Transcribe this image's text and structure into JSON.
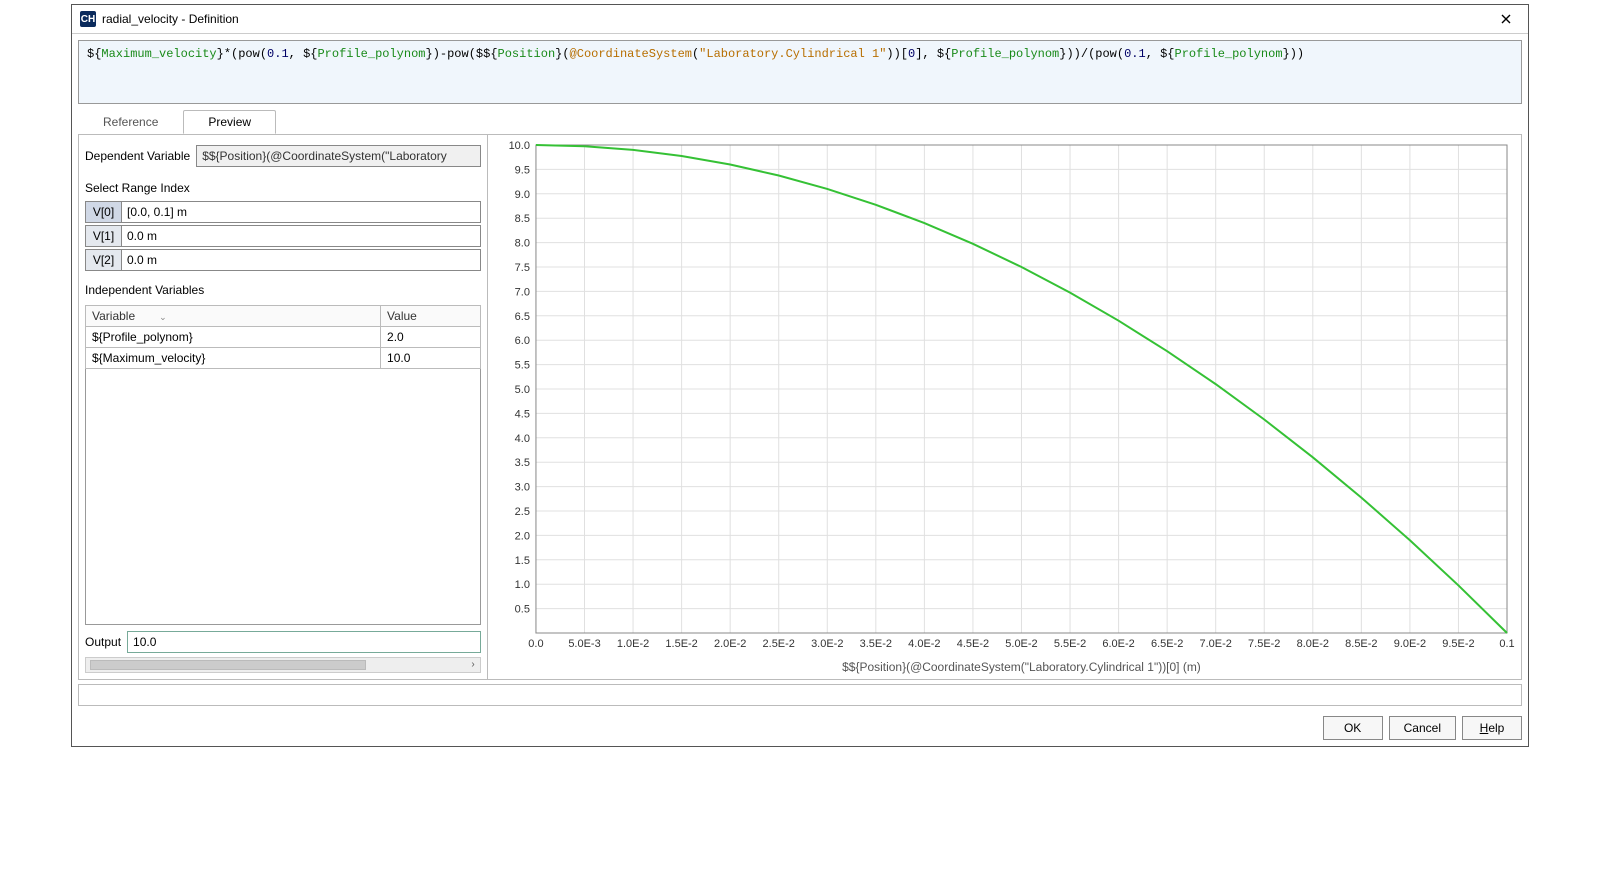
{
  "window": {
    "title": "radial_velocity - Definition"
  },
  "formula": {
    "segments": [
      {
        "t": "${",
        "c": "op"
      },
      {
        "t": "Maximum_velocity",
        "c": "var"
      },
      {
        "t": "}",
        "c": "op"
      },
      {
        "t": "*(pow(",
        "c": "op"
      },
      {
        "t": "0.1",
        "c": "num"
      },
      {
        "t": ", ",
        "c": "op"
      },
      {
        "t": "${",
        "c": "op"
      },
      {
        "t": "Profile_polynom",
        "c": "var"
      },
      {
        "t": "}",
        "c": "op"
      },
      {
        "t": ")-pow(",
        "c": "op"
      },
      {
        "t": "$${",
        "c": "op"
      },
      {
        "t": "Position",
        "c": "var"
      },
      {
        "t": "}",
        "c": "op"
      },
      {
        "t": "(",
        "c": "op"
      },
      {
        "t": "@CoordinateSystem",
        "c": "anno"
      },
      {
        "t": "(",
        "c": "op"
      },
      {
        "t": "\"Laboratory.Cylindrical 1\"",
        "c": "str"
      },
      {
        "t": "))[",
        "c": "op"
      },
      {
        "t": "0",
        "c": "num"
      },
      {
        "t": "], ",
        "c": "op"
      },
      {
        "t": "${",
        "c": "op"
      },
      {
        "t": "Profile_polynom",
        "c": "var"
      },
      {
        "t": "}",
        "c": "op"
      },
      {
        "t": "))/(pow(",
        "c": "op"
      },
      {
        "t": "0.1",
        "c": "num"
      },
      {
        "t": ", ",
        "c": "op"
      },
      {
        "t": "${",
        "c": "op"
      },
      {
        "t": "Profile_polynom",
        "c": "var"
      },
      {
        "t": "}",
        "c": "op"
      },
      {
        "t": "))",
        "c": "op"
      }
    ]
  },
  "tabs": {
    "reference": "Reference",
    "preview": "Preview",
    "active": "preview"
  },
  "left": {
    "dependent_label": "Dependent Variable",
    "dependent_value": "$${Position}(@CoordinateSystem(\"Laboratory",
    "range_label": "Select Range Index",
    "ranges": [
      {
        "idx": "V[0]",
        "val": "[0.0, 0.1] m",
        "selected": true
      },
      {
        "idx": "V[1]",
        "val": "0.0 m",
        "selected": false
      },
      {
        "idx": "V[2]",
        "val": "0.0 m",
        "selected": false
      }
    ],
    "indep_label": "Independent Variables",
    "table": {
      "headers": {
        "variable": "Variable",
        "value": "Value"
      },
      "rows": [
        {
          "variable": "${Profile_polynom}",
          "value": "2.0"
        },
        {
          "variable": "${Maximum_velocity}",
          "value": "10.0"
        }
      ]
    },
    "output_label": "Output",
    "output_value": "10.0"
  },
  "chart_data": {
    "type": "line",
    "title": "",
    "xlabel": "$${Position}(@CoordinateSystem(\"Laboratory.Cylindrical 1\"))[0] (m)",
    "ylabel": "",
    "xlim": [
      0.0,
      0.1
    ],
    "ylim": [
      0.0,
      10.0
    ],
    "x_ticks": [
      0.0,
      0.005,
      0.01,
      0.015,
      0.02,
      0.025,
      0.03,
      0.035,
      0.04,
      0.045,
      0.05,
      0.055,
      0.06,
      0.065,
      0.07,
      0.075,
      0.08,
      0.085,
      0.09,
      0.095,
      0.1
    ],
    "x_tick_labels": [
      "0.0",
      "5.0E-3",
      "1.0E-2",
      "1.5E-2",
      "2.0E-2",
      "2.5E-2",
      "3.0E-2",
      "3.5E-2",
      "4.0E-2",
      "4.5E-2",
      "5.0E-2",
      "5.5E-2",
      "6.0E-2",
      "6.5E-2",
      "7.0E-2",
      "7.5E-2",
      "8.0E-2",
      "8.5E-2",
      "9.0E-2",
      "9.5E-2",
      "0.1"
    ],
    "y_ticks": [
      0.5,
      1.0,
      1.5,
      2.0,
      2.5,
      3.0,
      3.5,
      4.0,
      4.5,
      5.0,
      5.5,
      6.0,
      6.5,
      7.0,
      7.5,
      8.0,
      8.5,
      9.0,
      9.5,
      10.0
    ],
    "y_tick_labels": [
      "0.5",
      "1.0",
      "1.5",
      "2.0",
      "2.5",
      "3.0",
      "3.5",
      "4.0",
      "4.5",
      "5.0",
      "5.5",
      "6.0",
      "6.5",
      "7.0",
      "7.5",
      "8.0",
      "8.5",
      "9.0",
      "9.5",
      "10.0"
    ],
    "series": [
      {
        "name": "radial_velocity",
        "x": [
          0.0,
          0.005,
          0.01,
          0.015,
          0.02,
          0.025,
          0.03,
          0.035,
          0.04,
          0.045,
          0.05,
          0.055,
          0.06,
          0.065,
          0.07,
          0.075,
          0.08,
          0.085,
          0.09,
          0.095,
          0.1
        ],
        "y": [
          10.0,
          9.975,
          9.9,
          9.775,
          9.6,
          9.375,
          9.1,
          8.775,
          8.4,
          7.975,
          7.5,
          6.975,
          6.4,
          5.775,
          5.1,
          4.375,
          3.6,
          2.775,
          1.9,
          0.975,
          0.0
        ]
      }
    ]
  },
  "buttons": {
    "ok": "OK",
    "cancel": "Cancel",
    "help": "Help"
  }
}
